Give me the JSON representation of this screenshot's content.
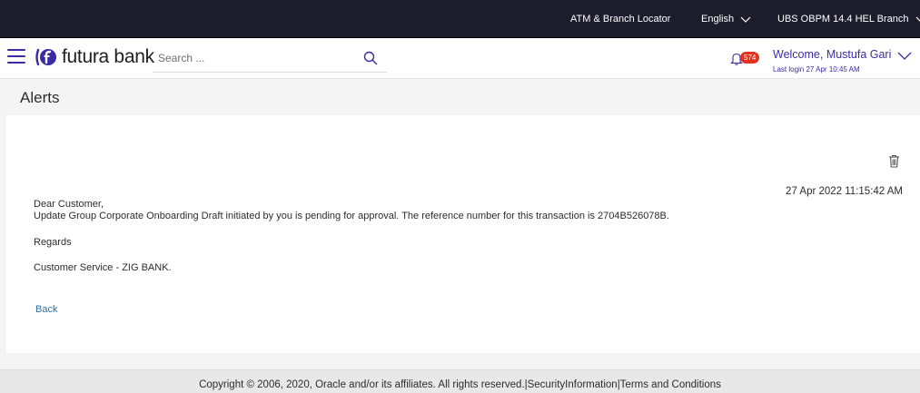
{
  "topbar": {
    "atm_locator": "ATM & Branch Locator",
    "language": "English",
    "branch": "UBS OBPM 14.4 HEL Branch"
  },
  "header": {
    "brand": "futura bank",
    "search_placeholder": "Search ...",
    "notification_count": "574",
    "welcome": "Welcome, Mustufa Gari",
    "last_login": "Last login 27 Apr 10:45 AM"
  },
  "page": {
    "title": "Alerts"
  },
  "alert": {
    "date": "27 Apr 2022 11:15:42 AM",
    "greeting": "Dear Customer,",
    "body": "Update Group Corporate Onboarding Draft initiated by you is pending for approval. The reference number for this transaction is 2704B526078B.",
    "regards": "Regards",
    "signature": "Customer Service - ZIG BANK."
  },
  "actions": {
    "back": "Back"
  },
  "footer": {
    "text": "Copyright © 2006, 2020, Oracle and/or its affiliates. All rights reserved.|SecurityInformation|Terms and Conditions"
  },
  "colors": {
    "topbar_bg": "#1d1c2c",
    "brand_purple": "#3a2ba5",
    "badge_red": "#e2311d",
    "link_blue": "#2a6fa8"
  }
}
